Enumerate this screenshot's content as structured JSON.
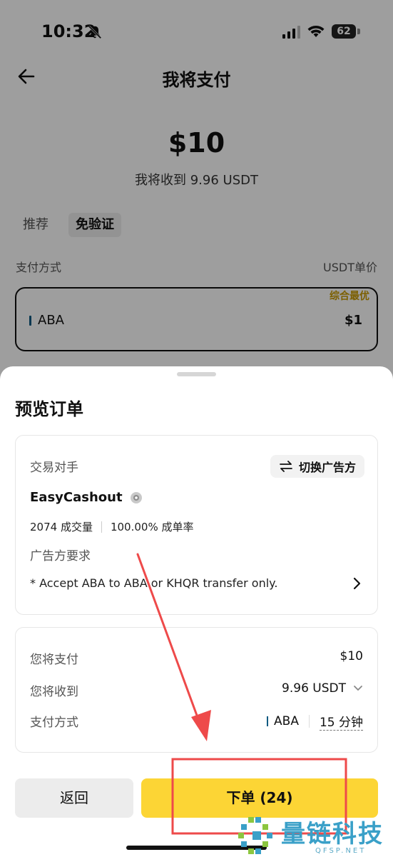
{
  "status_bar": {
    "time": "10:32",
    "battery": "62"
  },
  "header": {
    "title": "我将支付"
  },
  "summary": {
    "amount": "$10",
    "receive_text": "我将收到 9.96 USDT"
  },
  "tabs": [
    {
      "label": "推荐",
      "selected": false
    },
    {
      "label": "免验证",
      "selected": true
    }
  ],
  "list_header": {
    "payment_method_label": "支付方式",
    "price_label": "USDT单价"
  },
  "method_card": {
    "tag": "综合最优",
    "name": "ABA",
    "price": "$1",
    "bar_color": "#0a5a82"
  },
  "sheet": {
    "title": "预览订单",
    "counterparty": {
      "label": "交易对手",
      "switch_label": "切换广告方",
      "merchant_name": "EasyCashout",
      "trades": "2074 成交量",
      "completion": "100.00% 成单率",
      "requirements_label": "广告方要求",
      "requirements_text": "* Accept ABA to ABA or KHQR transfer only."
    },
    "details": {
      "pay_label": "您将支付",
      "pay_value": "$10",
      "receive_label": "您将收到",
      "receive_value": "9.96 USDT",
      "method_label": "支付方式",
      "method_value": "ABA",
      "time_limit": "15 分钟"
    },
    "buttons": {
      "back": "返回",
      "order": "下单 (24)"
    }
  },
  "colors": {
    "accent_yellow": "#fcd535",
    "best_tag": "#c99a00",
    "annotation_red": "#ee4a4a"
  },
  "watermark": {
    "text": "量链科技",
    "sub": "QFSP.NET"
  }
}
